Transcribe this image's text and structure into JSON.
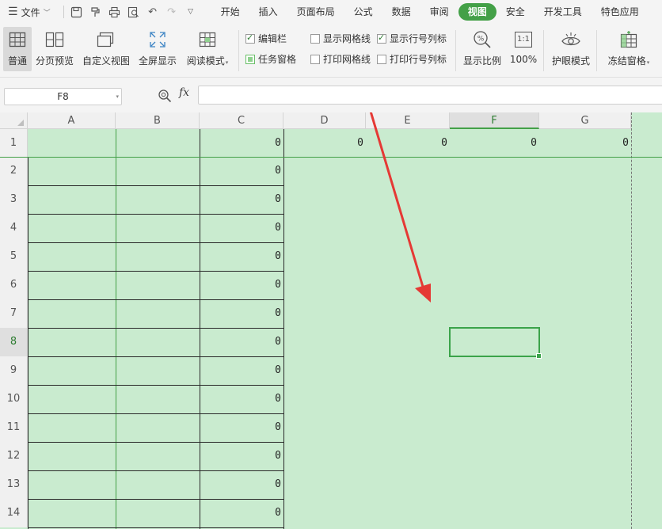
{
  "menubar": {
    "file_label": "文件",
    "tabs": [
      {
        "label": "开始"
      },
      {
        "label": "插入"
      },
      {
        "label": "页面布局"
      },
      {
        "label": "公式"
      },
      {
        "label": "数据"
      },
      {
        "label": "审阅"
      },
      {
        "label": "视图"
      },
      {
        "label": "安全"
      },
      {
        "label": "开发工具"
      },
      {
        "label": "特色应用"
      }
    ],
    "active_tab": "视图"
  },
  "ribbon": {
    "normal": "普通",
    "page_break_preview": "分页预览",
    "custom_view": "自定义视图",
    "full_screen": "全屏显示",
    "reading_mode": "阅读模式",
    "edit_bar": "编辑栏",
    "task_pane": "任务窗格",
    "show_gridlines": "显示网格线",
    "print_gridlines": "打印网格线",
    "show_headings": "显示行号列标",
    "print_headings": "打印行号列标",
    "zoom": "显示比例",
    "zoom_100": "100%",
    "zoom_100_icon_text": "1:1",
    "eye_protection": "护眼模式",
    "freeze_panes": "冻结窗格",
    "checkbox_states": {
      "edit_bar": true,
      "task_pane": "partial",
      "show_gridlines": false,
      "print_gridlines": false,
      "show_headings": true,
      "print_headings": false
    }
  },
  "formula_bar": {
    "name_box": "F8",
    "fx_label": "fx",
    "formula": ""
  },
  "sheet": {
    "columns": [
      "A",
      "B",
      "C",
      "D",
      "E",
      "F",
      "G"
    ],
    "selected_column": "F",
    "rows": [
      "1",
      "2",
      "3",
      "4",
      "5",
      "6",
      "7",
      "8",
      "9",
      "10",
      "11",
      "12",
      "13",
      "14"
    ],
    "selected_row": "8",
    "row1_values": {
      "C": "0",
      "D": "0",
      "E": "0",
      "F": "0",
      "G": "0"
    },
    "column_c_values": [
      "0",
      "0",
      "0",
      "0",
      "0",
      "0",
      "0",
      "0",
      "0",
      "0",
      "0",
      "0",
      "0",
      "0"
    ],
    "background_color": "#c9ebcf",
    "accent_color": "#43a047",
    "annotation_arrow_color": "#e53935"
  }
}
